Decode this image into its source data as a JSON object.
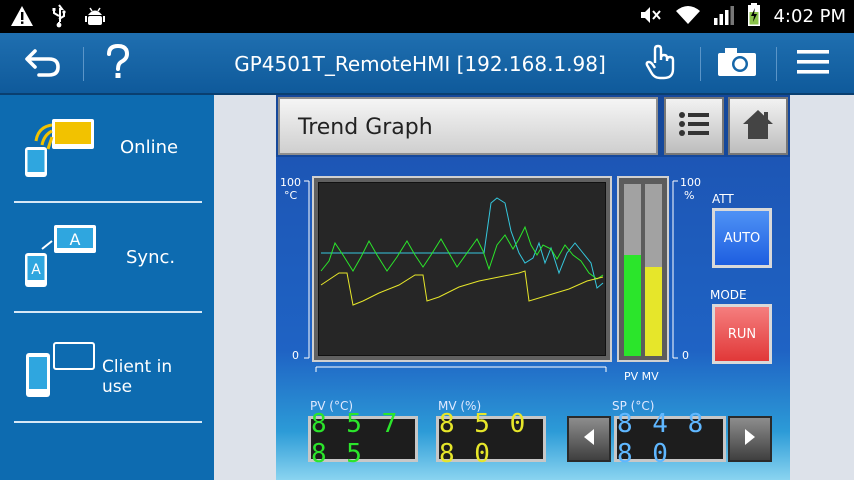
{
  "status_bar": {
    "time": "4:02 PM",
    "left_icons": [
      "warning-icon",
      "usb-icon",
      "android-debug-icon"
    ],
    "right_icons": [
      "mute-icon",
      "wifi-icon",
      "signal-icon",
      "battery-charging-icon"
    ]
  },
  "action_bar": {
    "title": "GP4501T_RemoteHMI [192.168.1.98]",
    "left_icons": [
      "back-icon",
      "help-icon"
    ],
    "right_icons": [
      "touch-icon",
      "camera-icon",
      "menu-icon"
    ]
  },
  "sidebar": {
    "items": [
      {
        "label": "Online",
        "icon": "online-icon"
      },
      {
        "label": "Sync.",
        "icon": "sync-icon"
      },
      {
        "label": "Client in use",
        "icon": "client-icon"
      }
    ]
  },
  "hmi": {
    "title": "Trend Graph",
    "list_button_icon": "list-icon",
    "home_button_icon": "home-icon",
    "axis": {
      "left_top": "100",
      "left_unit": "°C",
      "left_bottom": "0",
      "right_top": "100",
      "right_unit": "%",
      "right_bottom": "0"
    },
    "bar_labels": "PV MV",
    "bars": {
      "pv": 0.59,
      "mv": 0.52
    },
    "att": {
      "label": "ATT",
      "button": "AUTO"
    },
    "mode": {
      "label": "MODE",
      "button": "RUN"
    },
    "pv": {
      "label": "PV (°C)",
      "value": "8 5 7 8 5"
    },
    "mv": {
      "label": "MV (%)",
      "value": "8 5 0 8 0"
    },
    "sp": {
      "label": "SP (°C)",
      "value": "8 4 8 8 0"
    },
    "colors": {
      "pv": "#2be52b",
      "mv": "#e6e62a",
      "sp": "#5fb7ff",
      "cyan": "#35c7dd"
    }
  }
}
